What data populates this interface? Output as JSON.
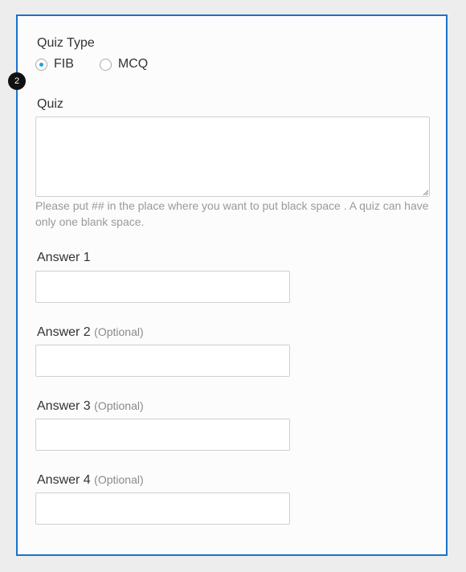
{
  "step_badge": "2",
  "quiz_type": {
    "label": "Quiz Type",
    "options": [
      {
        "label": "FIB",
        "selected": true
      },
      {
        "label": "MCQ",
        "selected": false
      }
    ]
  },
  "quiz": {
    "label": "Quiz",
    "value": "",
    "help_text": "Please put ## in the place where you want to put black space . A quiz can have only one blank space."
  },
  "answers": [
    {
      "label": "Answer 1",
      "optional": "",
      "value": ""
    },
    {
      "label": "Answer 2",
      "optional": "(Optional)",
      "value": ""
    },
    {
      "label": "Answer 3",
      "optional": "(Optional)",
      "value": ""
    },
    {
      "label": "Answer 4",
      "optional": "(Optional)",
      "value": ""
    }
  ],
  "colors": {
    "panel_border": "#1a73c9",
    "radio_selected": "#1ea4d8",
    "help_text": "#9a9a9a"
  }
}
